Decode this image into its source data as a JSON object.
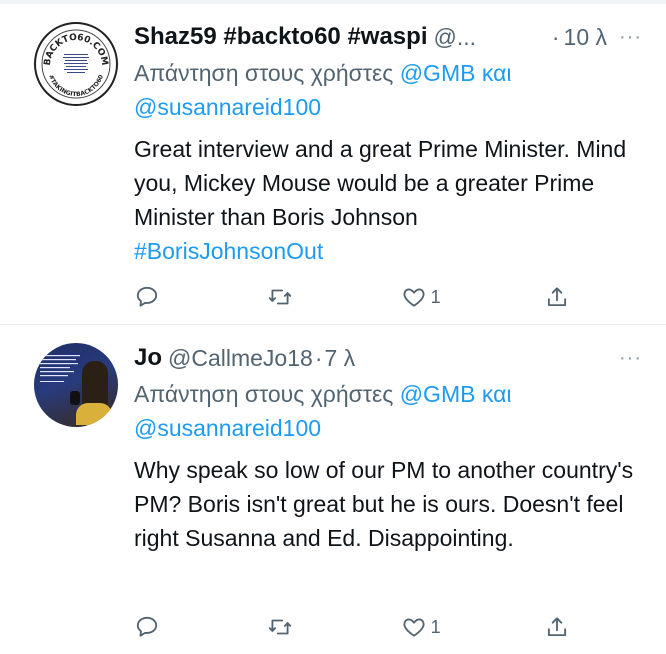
{
  "tweets": [
    {
      "display_name": "Shaz59 #backto60 #waspi",
      "handle": "@...",
      "separator": "·",
      "time": "10 λ",
      "more": "···",
      "reply_prefix": "Απάντηση στους χρήστες",
      "reply_mention_1": "@GMB",
      "reply_and": "και",
      "reply_mention_2": "@susannareid100",
      "text": "Great interview and a great Prime Minister. Mind you, Mickey Mouse would be a greater Prime Minister than Boris Johnson",
      "hashtag": "#BorisJohnsonOut",
      "avatar_text": "BACKTO60.COM · #TAKINGITBACKTO60",
      "actions": {
        "reply_count": "",
        "retweet_count": "",
        "like_count": "1"
      }
    },
    {
      "display_name": "Jo",
      "handle": "@CallmeJo18",
      "separator": "·",
      "time": "7 λ",
      "more": "···",
      "reply_prefix": "Απάντηση στους χρήστες",
      "reply_mention_1": "@GMB",
      "reply_and": "και",
      "reply_mention_2": "@susannareid100",
      "text": "Why speak so low of our PM to another country's PM? Boris isn't great but he is ours. Doesn't feel right Susanna and Ed. Disappointing.",
      "hashtag": "",
      "actions": {
        "reply_count": "",
        "retweet_count": "",
        "like_count": "1"
      }
    }
  ],
  "colors": {
    "accent": "#1d9bf0",
    "muted": "#536471",
    "text": "#0f1419"
  }
}
